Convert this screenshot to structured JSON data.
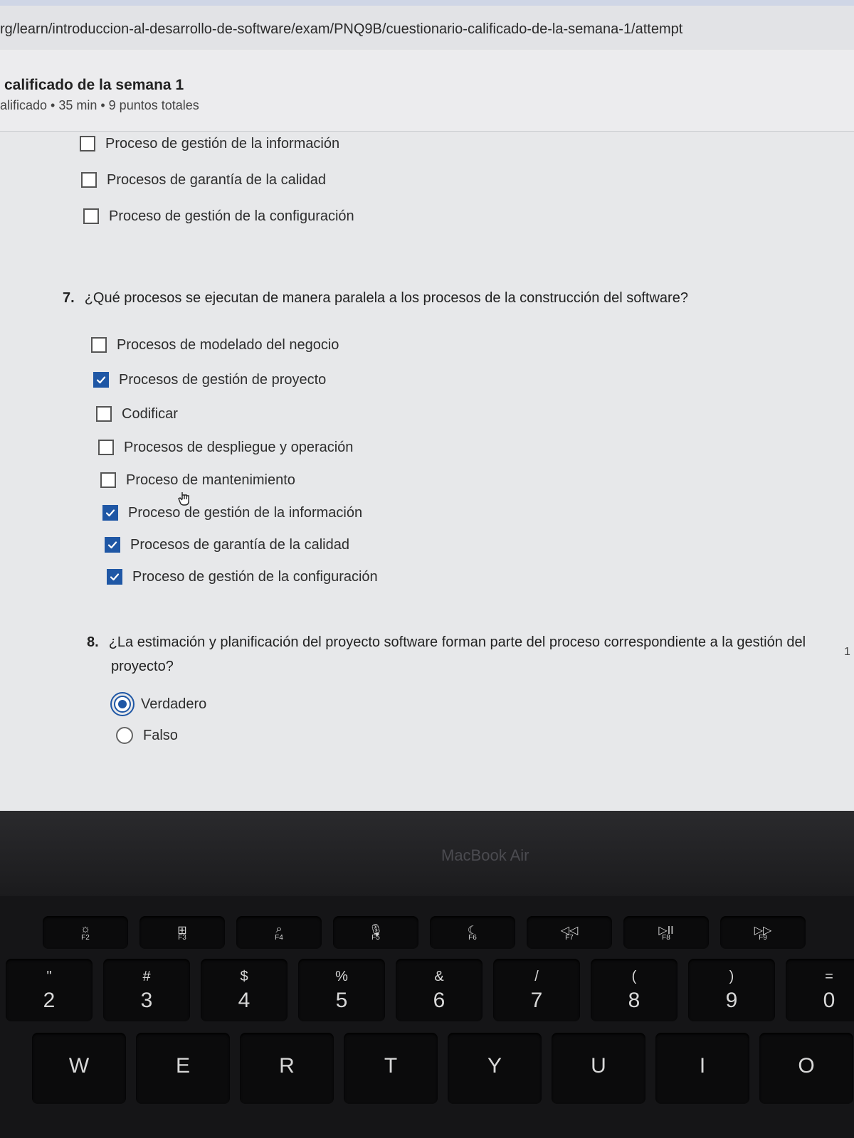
{
  "browser": {
    "url": "rg/learn/introduccion-al-desarrollo-de-software/exam/PNQ9B/cuestionario-calificado-de-la-semana-1/attempt"
  },
  "quiz": {
    "title": "calificado de la semana 1",
    "meta": "alificado • 35 min • 9 puntos totales"
  },
  "q6_tail": {
    "options": [
      {
        "label": "Proceso de gestión de la información",
        "checked": false
      },
      {
        "label": "Procesos de garantía de la calidad",
        "checked": false
      },
      {
        "label": "Proceso de gestión de la configuración",
        "checked": false
      }
    ]
  },
  "q7": {
    "number": "7.",
    "text": "¿Qué procesos se ejecutan de manera paralela a los procesos de la construcción del software?",
    "options": [
      {
        "label": "Procesos de modelado del negocio",
        "checked": false
      },
      {
        "label": "Procesos de gestión de proyecto",
        "checked": true
      },
      {
        "label": "Codificar",
        "checked": false
      },
      {
        "label": "Procesos de despliegue y operación",
        "checked": false
      },
      {
        "label": "Proceso de mantenimiento",
        "checked": false
      },
      {
        "label": "Proceso de gestión de la información",
        "checked": true
      },
      {
        "label": "Procesos de garantía de la calidad",
        "checked": true
      },
      {
        "label": "Proceso de gestión de la configuración",
        "checked": true
      }
    ]
  },
  "q8": {
    "number": "8.",
    "text_line1": "¿La estimación y planificación del proyecto software forman parte del proceso correspondiente a la gestión del",
    "text_line2": "proyecto?",
    "options": [
      {
        "label": "Verdadero",
        "selected": true
      },
      {
        "label": "Falso",
        "selected": false
      }
    ]
  },
  "edge_number": "1",
  "laptop": {
    "brand": "MacBook Air"
  },
  "keys": {
    "fn": [
      {
        "icon": "☼",
        "label": "F2"
      },
      {
        "icon": "⊞",
        "label": "F3"
      },
      {
        "icon": "⌕",
        "label": "F4"
      },
      {
        "icon": "🎙",
        "label": "F5"
      },
      {
        "icon": "☾",
        "label": "F6"
      },
      {
        "icon": "◁◁",
        "label": "F7"
      },
      {
        "icon": "▷II",
        "label": "F8"
      },
      {
        "icon": "▷▷",
        "label": "F9"
      }
    ],
    "num": [
      {
        "sub": "\"",
        "main": "2"
      },
      {
        "sub": "#",
        "main": "3"
      },
      {
        "sub": "$",
        "main": "4"
      },
      {
        "sub": "%",
        "main": "5"
      },
      {
        "sub": "&",
        "main": "6"
      },
      {
        "sub": "/",
        "main": "7"
      },
      {
        "sub": "(",
        "main": "8"
      },
      {
        "sub": ")",
        "main": "9"
      },
      {
        "sub": "=",
        "main": "0"
      }
    ],
    "letters": [
      "W",
      "E",
      "R",
      "T",
      "Y",
      "U",
      "I",
      "O"
    ]
  }
}
